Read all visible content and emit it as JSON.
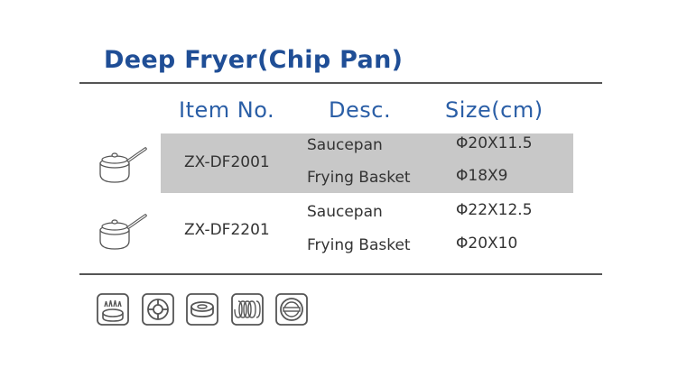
{
  "title": "Deep Fryer(Chip Pan)",
  "table": {
    "headers": {
      "item_no": "Item No.",
      "desc": "Desc.",
      "size": "Size(cm)"
    },
    "rows": [
      {
        "item_no": "ZX-DF2001",
        "highlighted": true,
        "lines": [
          {
            "desc": "Saucepan",
            "size": "Φ20X11.5"
          },
          {
            "desc": "Frying Basket",
            "size": "Φ18X9"
          }
        ]
      },
      {
        "item_no": "ZX-DF2201",
        "highlighted": false,
        "lines": [
          {
            "desc": "Saucepan",
            "size": "Φ22X12.5"
          },
          {
            "desc": "Frying Basket",
            "size": "Φ20X10"
          }
        ]
      }
    ]
  },
  "product_icons": [
    "saucepan-icon",
    "saucepan-icon"
  ],
  "cooktop_icons": [
    "gas-stove-icon",
    "electric-hob-icon",
    "ceramic-hob-icon",
    "halogen-hob-icon",
    "induction-hob-icon"
  ],
  "colors": {
    "title": "#1f4e96",
    "header": "#2a5ea6",
    "row_highlight": "#c8c8c8",
    "text": "#333333",
    "rule": "#555555"
  }
}
